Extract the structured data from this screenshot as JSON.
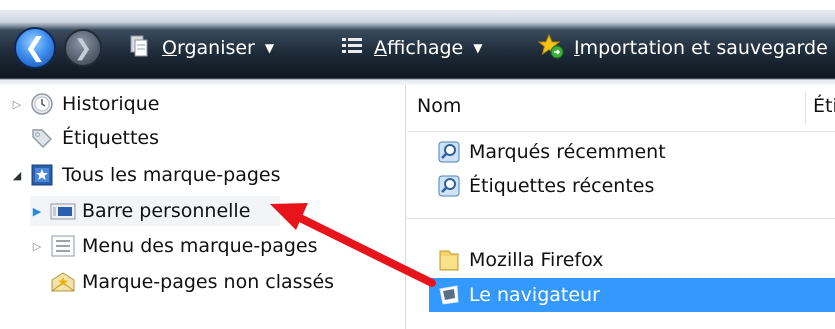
{
  "toolbar": {
    "organiser": {
      "first": "O",
      "rest": "rganiser"
    },
    "affichage": {
      "first": "A",
      "rest": "ffichage"
    },
    "importation": {
      "first": "I",
      "rest": "mportation et sauvegarde"
    }
  },
  "sidebar": {
    "items": [
      {
        "label": "Historique"
      },
      {
        "label": "Étiquettes"
      },
      {
        "label": "Tous les marque-pages"
      },
      {
        "label": "Barre personnelle"
      },
      {
        "label": "Menu des marque-pages"
      },
      {
        "label": "Marque-pages non classés"
      }
    ]
  },
  "main": {
    "columns": [
      "Nom",
      "Éti"
    ],
    "items": [
      {
        "label": "Marqués récemment"
      },
      {
        "label": "Étiquettes récentes"
      },
      {
        "label": "Mozilla Firefox"
      },
      {
        "label": "Le navigateur"
      }
    ]
  },
  "colors": {
    "selection": "#3399ff",
    "arrow": "#e8141c",
    "toolbar_dark": "#1f2c3a"
  }
}
